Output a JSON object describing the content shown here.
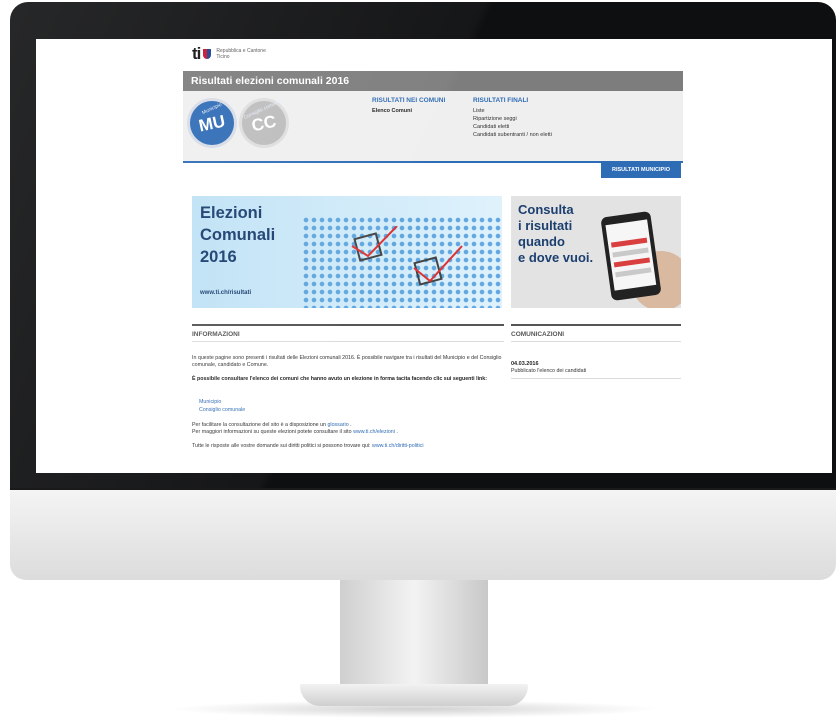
{
  "logo": {
    "mark": "ti",
    "text_line1": "Repubblica e Cantone",
    "text_line2": "Ticino",
    "shield_colors": [
      "#c8102e",
      "#1d3f8f"
    ]
  },
  "title_bar": "Risultati elezioni comunali 2016",
  "nav": {
    "municipio": {
      "caption": "Municipio",
      "abbr": "MU",
      "color": "#2f6cb6"
    },
    "consiglio": {
      "caption": "Consiglio comunale",
      "abbr": "CC",
      "color": "#bdbdbd"
    },
    "col_comuni": {
      "heading": "RISULTATI NEI COMUNI",
      "items": [
        "Elenco Comuni"
      ]
    },
    "col_finali": {
      "heading": "RISULTATI FINALI",
      "items": [
        "Liste",
        "Ripartizione seggi",
        "Candidati eletti",
        "Candidati subentranti / non eletti"
      ]
    }
  },
  "tab_button": "RISULTATI MUNICIPIO",
  "banner_main": {
    "line1": "Elezioni",
    "line2": "Comunali",
    "line3": "2016",
    "url": "www.ti.ch/risultati"
  },
  "banner_mobile": {
    "line1": "Consulta",
    "line2": "i risultati",
    "line3": "quando",
    "line4": "e dove vuoi."
  },
  "informazioni": {
    "heading": "INFORMAZIONI",
    "intro": "In queste pagine sono presenti i risultati delle Elezioni comunali 2016. È possibile navigare tra i risultati del Municipio e del Consiglio comunale, candidato e Comune.",
    "tacit": "È possibile consultare l'elenco dei comuni che hanno avuto un elezione in forma tacita facendo clic sui seguenti link:",
    "links": [
      "Municipio",
      "Consiglio comunale"
    ],
    "glossary_pre": "Per facilitare la consultazione del sito è a disposizione un",
    "glossary_link": "glossario",
    "more_pre": "Per maggiori informazioni su queste elezioni potete consultare il sito",
    "more_link": "www.ti.ch/elezioni",
    "faq_pre": "Tutte le risposte alle vostre domande sui diritti politici si possono trovare qui:",
    "faq_link": "www.ti.ch/diritti-politici"
  },
  "comunicazioni": {
    "heading": "COMUNICAZIONI",
    "date": "04.03.2016",
    "text": "Pubblicato l'elenco dei candidati"
  },
  "colors": {
    "accent": "#2f6cb6",
    "title_bar": "#7d7d7d",
    "nav_bg": "#efefef"
  }
}
